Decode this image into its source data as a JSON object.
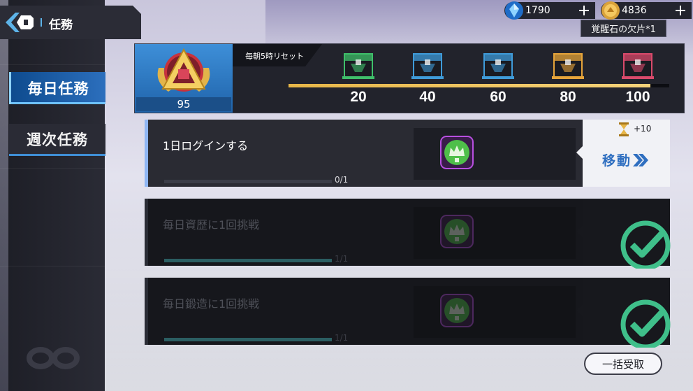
{
  "header": {
    "title": "任務",
    "back_icon": "back-arrow-icon"
  },
  "currency": [
    {
      "name": "gem",
      "icon": "crystal-icon",
      "value": "1790"
    },
    {
      "name": "coin",
      "icon": "coin-icon",
      "value": "4836"
    }
  ],
  "tooltip": "覚醒石の欠片*1",
  "tabs": [
    {
      "label": "毎日任務",
      "active": true
    },
    {
      "label": "週次任務",
      "active": false
    }
  ],
  "progress": {
    "level": "95",
    "reset_label": "毎朝5時リセット",
    "current": 95,
    "max": 100,
    "milestones": [
      {
        "label": "20",
        "chest": "chest-icon",
        "color": "#3fbf6a"
      },
      {
        "label": "40",
        "chest": "chest-icon",
        "color": "#3f9bd9"
      },
      {
        "label": "60",
        "chest": "chest-icon",
        "color": "#3f9bd9"
      },
      {
        "label": "80",
        "chest": "chest-icon",
        "color": "#e6a43a"
      },
      {
        "label": "100",
        "chest": "chest-icon",
        "color": "#d94a6b"
      }
    ]
  },
  "missions": [
    {
      "name": "1日ログインする",
      "count": "0/1",
      "progress": 0.0,
      "points": "+10",
      "action": "移動",
      "done": false
    },
    {
      "name": "毎日資歴に1回挑戦",
      "count": "1/1",
      "progress": 1.0,
      "points": "",
      "action": "",
      "done": true
    },
    {
      "name": "毎日鍛造に1回挑戦",
      "count": "1/1",
      "progress": 1.0,
      "points": "",
      "action": "",
      "done": true
    }
  ],
  "claim_all": "一括受取"
}
